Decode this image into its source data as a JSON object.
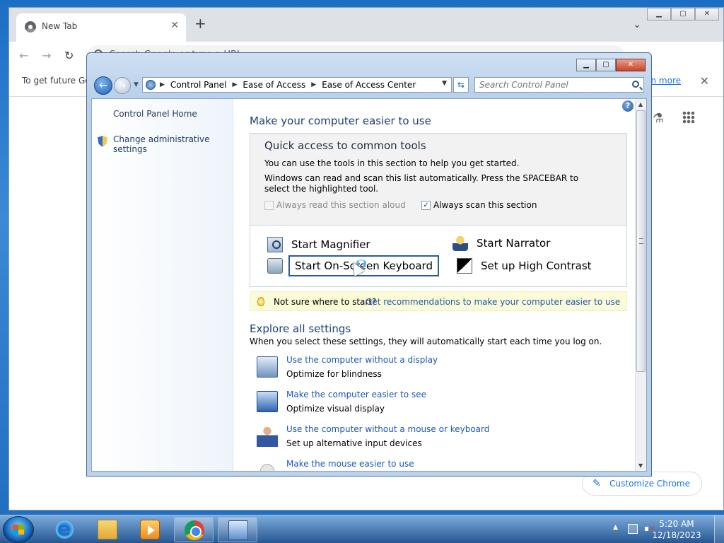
{
  "browser": {
    "tab_title": "New Tab",
    "omnibox_placeholder": "Search Google or type a URL",
    "infobar_text": "To get future Google Chrome updates, you'll need Windows 10 or later.",
    "infobar_link": "Learn more",
    "customize_label": "Customize Chrome"
  },
  "cp": {
    "breadcrumb": [
      "Control Panel",
      "Ease of Access",
      "Ease of Access Center"
    ],
    "search_placeholder": "Search Control Panel",
    "sidebar": {
      "home": "Control Panel Home",
      "admin": "Change administrative settings"
    },
    "heading": "Make your computer easier to use",
    "quick_access": {
      "title": "Quick access to common tools",
      "desc1": "You can use the tools in this section to help you get started.",
      "desc2": "Windows can read and scan this list automatically.  Press the SPACEBAR to select the highlighted tool.",
      "read_aloud": {
        "label": "Always read this section aloud",
        "checked": false,
        "enabled": false
      },
      "scan": {
        "label": "Always scan this section",
        "checked": true,
        "enabled": true
      }
    },
    "tools": {
      "magnifier": "Start Magnifier",
      "narrator": "Start Narrator",
      "keyboard": "Start On-Screen Keyboard",
      "contrast": "Set up High Contrast"
    },
    "hint": {
      "question": "Not sure where to start?",
      "link": "Get recommendations to make your computer easier to use"
    },
    "explore": {
      "title": "Explore all settings",
      "desc": "When you select these settings, they will automatically start each time you log on.",
      "items": [
        {
          "link": "Use the computer without a display",
          "sub": "Optimize for blindness"
        },
        {
          "link": "Make the computer easier to see",
          "sub": "Optimize visual display"
        },
        {
          "link": "Use the computer without a mouse or keyboard",
          "sub": "Set up alternative input devices"
        },
        {
          "link": "Make the mouse easier to use",
          "sub": ""
        }
      ]
    }
  },
  "taskbar": {
    "time": "5:20 AM",
    "date": "12/18/2023"
  }
}
